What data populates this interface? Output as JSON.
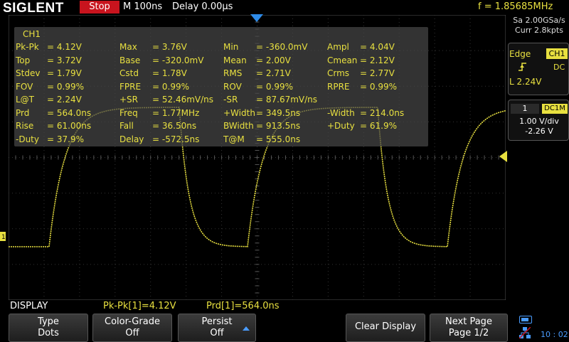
{
  "topbar": {
    "brand": "SIGLENT",
    "run_state": "Stop",
    "timebase": "M 100ns",
    "delay": "Delay 0.00µs",
    "frequency": "f = 1.85685MHz"
  },
  "acquisition": {
    "sample_rate": "Sa 2.00GSa/s",
    "memory": "Curr 2.8kpts"
  },
  "trigger": {
    "type": "Edge",
    "source": "CH1",
    "slope_icon": "rising-edge-icon",
    "coupling": "DC",
    "level": "L  2.24V"
  },
  "channel": {
    "number": "1",
    "coupling": "DC1M",
    "scale": "1.00 V/div",
    "offset": "-2.26 V"
  },
  "measurements": {
    "title": "CH1",
    "rows": [
      [
        [
          "Pk-Pk",
          "= 4.12V"
        ],
        [
          "Max",
          "= 3.76V"
        ],
        [
          "Min",
          "= -360.0mV"
        ],
        [
          "Ampl",
          "= 4.04V"
        ]
      ],
      [
        [
          "Top",
          "= 3.72V"
        ],
        [
          "Base",
          "= -320.0mV"
        ],
        [
          "Mean",
          "= 2.00V"
        ],
        [
          "Cmean",
          "= 2.12V"
        ]
      ],
      [
        [
          "Stdev",
          "= 1.79V"
        ],
        [
          "Cstd",
          "= 1.78V"
        ],
        [
          "RMS",
          "= 2.71V"
        ],
        [
          "Crms",
          "= 2.77V"
        ]
      ],
      [
        [
          "FOV",
          "= 0.99%"
        ],
        [
          "FPRE",
          "= 0.99%"
        ],
        [
          "ROV",
          "= 0.99%"
        ],
        [
          "RPRE",
          "= 0.99%"
        ]
      ],
      [
        [
          "L@T",
          "= 2.24V"
        ],
        [
          "+SR",
          "= 52.46mV/ns"
        ],
        [
          "-SR",
          "= 87.67mV/ns"
        ],
        [
          "",
          ""
        ]
      ],
      [
        [
          "Prd",
          "= 564.0ns"
        ],
        [
          "Freq",
          "= 1.77MHz"
        ],
        [
          "+Width",
          "= 349.5ns"
        ],
        [
          "-Width",
          "= 214.0ns"
        ]
      ],
      [
        [
          "Rise",
          "= 61.00ns"
        ],
        [
          "Fall",
          "= 36.50ns"
        ],
        [
          "BWidth",
          "= 913.5ns"
        ],
        [
          "+Duty",
          "= 61.9%"
        ]
      ],
      [
        [
          "-Duty",
          "= 37.9%"
        ],
        [
          "Delay",
          "= -572.5ns"
        ],
        [
          "T@M",
          "= 555.0ns"
        ],
        [
          "",
          ""
        ]
      ]
    ]
  },
  "status": {
    "menu_name": "DISPLAY",
    "measure1": "Pk-Pk[1]=4.12V",
    "measure2": "Prd[1]=564.0ns"
  },
  "softkeys": {
    "type_label": "Type",
    "type_value": "Dots",
    "color_label": "Color-Grade",
    "color_value": "Off",
    "persist_label": "Persist",
    "persist_value": "Off",
    "clear_label": "Clear Display",
    "next_label": "Next Page",
    "next_value": "Page 1/2"
  },
  "clock": "10 : 02",
  "colors": {
    "trace": "#e8e040",
    "run_stop": "#c8141e",
    "icons": "#4a9cff"
  }
}
